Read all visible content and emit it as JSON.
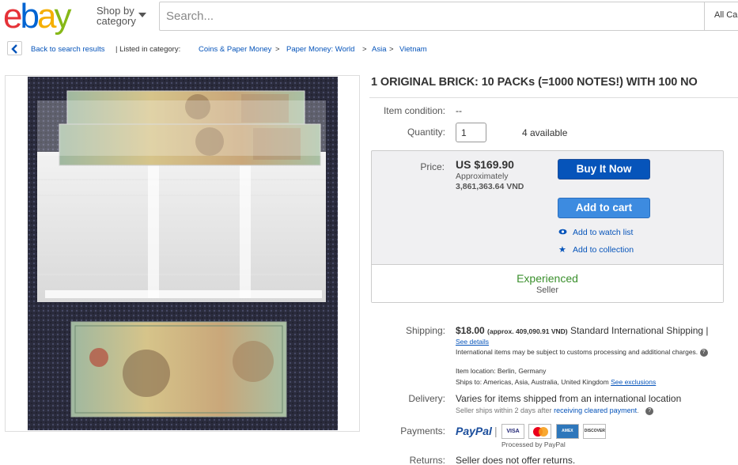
{
  "header": {
    "logo_letters": [
      "e",
      "b",
      "a",
      "y"
    ],
    "logo_colors": [
      "#e53238",
      "#0064d2",
      "#f5af02",
      "#86b817"
    ],
    "shop_by_line1": "Shop by",
    "shop_by_line2": "category",
    "search_placeholder": "Search...",
    "all_categories": "All Ca"
  },
  "breadcrumb": {
    "back_label": "Back to search results",
    "separator_text": "| Listed in category:",
    "items": [
      "Coins & Paper Money",
      ">",
      "Paper Money: World",
      ">",
      "Asia",
      ">",
      "Vietnam"
    ]
  },
  "listing": {
    "title": "1 ORIGINAL BRICK: 10 PACKs (=1000 NOTES!) WITH 100 NO",
    "item_condition_label": "Item condition:",
    "item_condition_value": "--",
    "quantity_label": "Quantity:",
    "quantity_value": "1",
    "available": "4 available",
    "price_label": "Price:",
    "price": "US $169.90",
    "approx_label": "Approximately",
    "approx_value": "3,861,363.64 VND",
    "buy_now": "Buy It Now",
    "add_to_cart": "Add to cart",
    "watch_list": "Add to watch list",
    "collection": "Add to collection",
    "seller_badge": "Experienced",
    "seller_label": "Seller"
  },
  "shipping": {
    "label": "Shipping:",
    "price": "$18.00",
    "approx": "(approx. 409,090.91 VND)",
    "method": "Standard International Shipping |",
    "see_details": "See details",
    "note": "International items may be subject to customs processing and additional charges.",
    "location": "Item location:  Berlin, Germany",
    "ships_to": "Ships to:  Americas, Asia, Australia, United Kingdom",
    "see_exclusions": "See exclusions"
  },
  "delivery": {
    "label": "Delivery:",
    "value": "Varies for items shipped from an international location",
    "note_prefix": "Seller ships within 2 days after",
    "note_link": "receiving cleared payment",
    "note_suffix": "."
  },
  "payments": {
    "label": "Payments:",
    "paypal": "PayPal",
    "processed": "Processed by PayPal",
    "cards": [
      "VISA",
      "MC",
      "AMEX",
      "DISCOVER"
    ]
  },
  "returns": {
    "label": "Returns:",
    "value": "Seller does not offer returns."
  },
  "colors": {
    "link": "#0654ba",
    "buy_button": "#0654ba",
    "cart_button": "#3d8be0",
    "experienced": "#3a8f2c"
  }
}
